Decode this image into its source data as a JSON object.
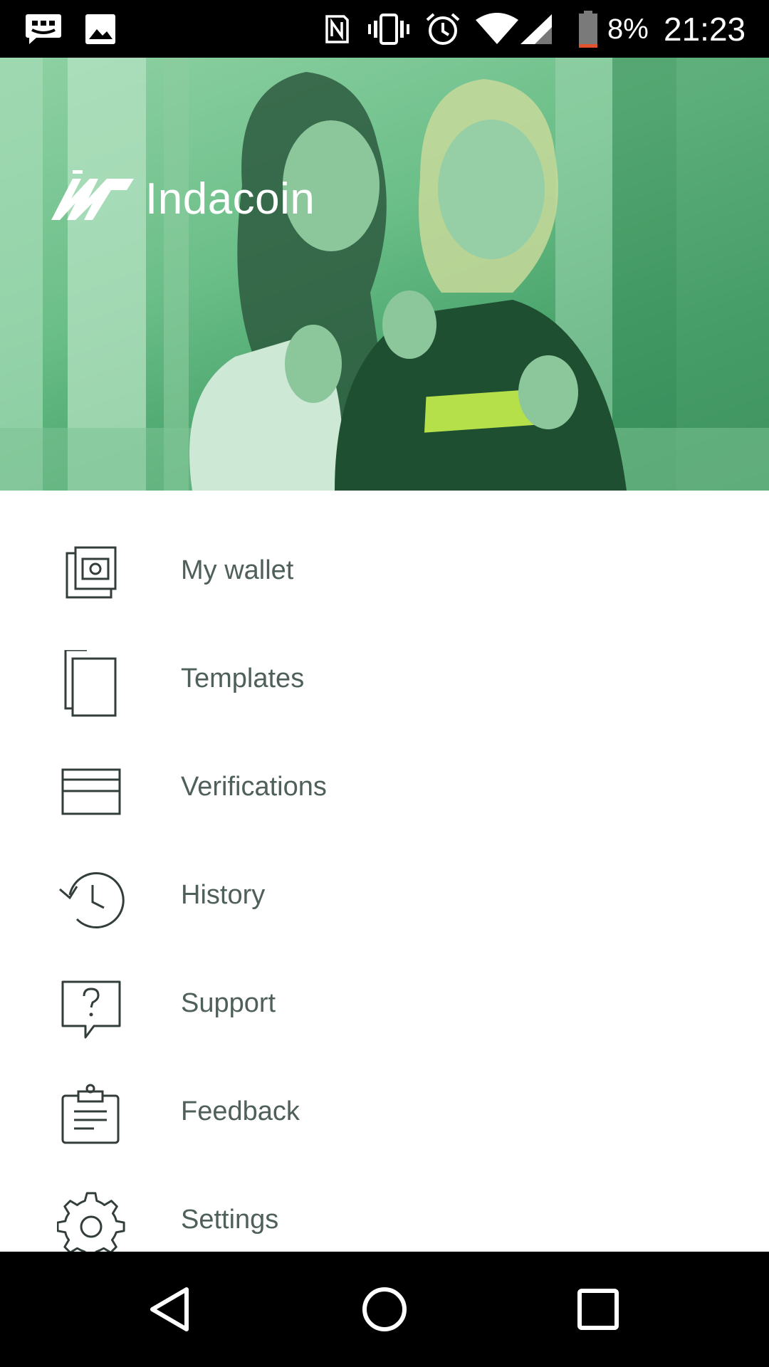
{
  "status_bar": {
    "icons": [
      "messenger-icon",
      "gallery-icon",
      "nfc-icon",
      "vibrate-icon",
      "alarm-icon",
      "wifi-icon",
      "signal-icon",
      "battery-icon"
    ],
    "battery_text": "8%",
    "clock": "21:23"
  },
  "header": {
    "logo_text": "Indacoin",
    "accent_color": "#5fb984"
  },
  "menu": {
    "items": [
      {
        "label": "My wallet",
        "icon": "wallet-icon"
      },
      {
        "label": "Templates",
        "icon": "copy-icon"
      },
      {
        "label": "Verifications",
        "icon": "card-icon"
      },
      {
        "label": "History",
        "icon": "history-icon"
      },
      {
        "label": "Support",
        "icon": "help-bubble-icon"
      },
      {
        "label": "Feedback",
        "icon": "clipboard-icon"
      },
      {
        "label": "Settings",
        "icon": "gear-icon"
      }
    ]
  },
  "nav_bar": {
    "buttons": [
      "back-icon",
      "home-icon",
      "recents-icon"
    ]
  },
  "colors": {
    "text": "#4f5f5a",
    "icon_stroke": "#333d3a",
    "bars": "#000000"
  }
}
